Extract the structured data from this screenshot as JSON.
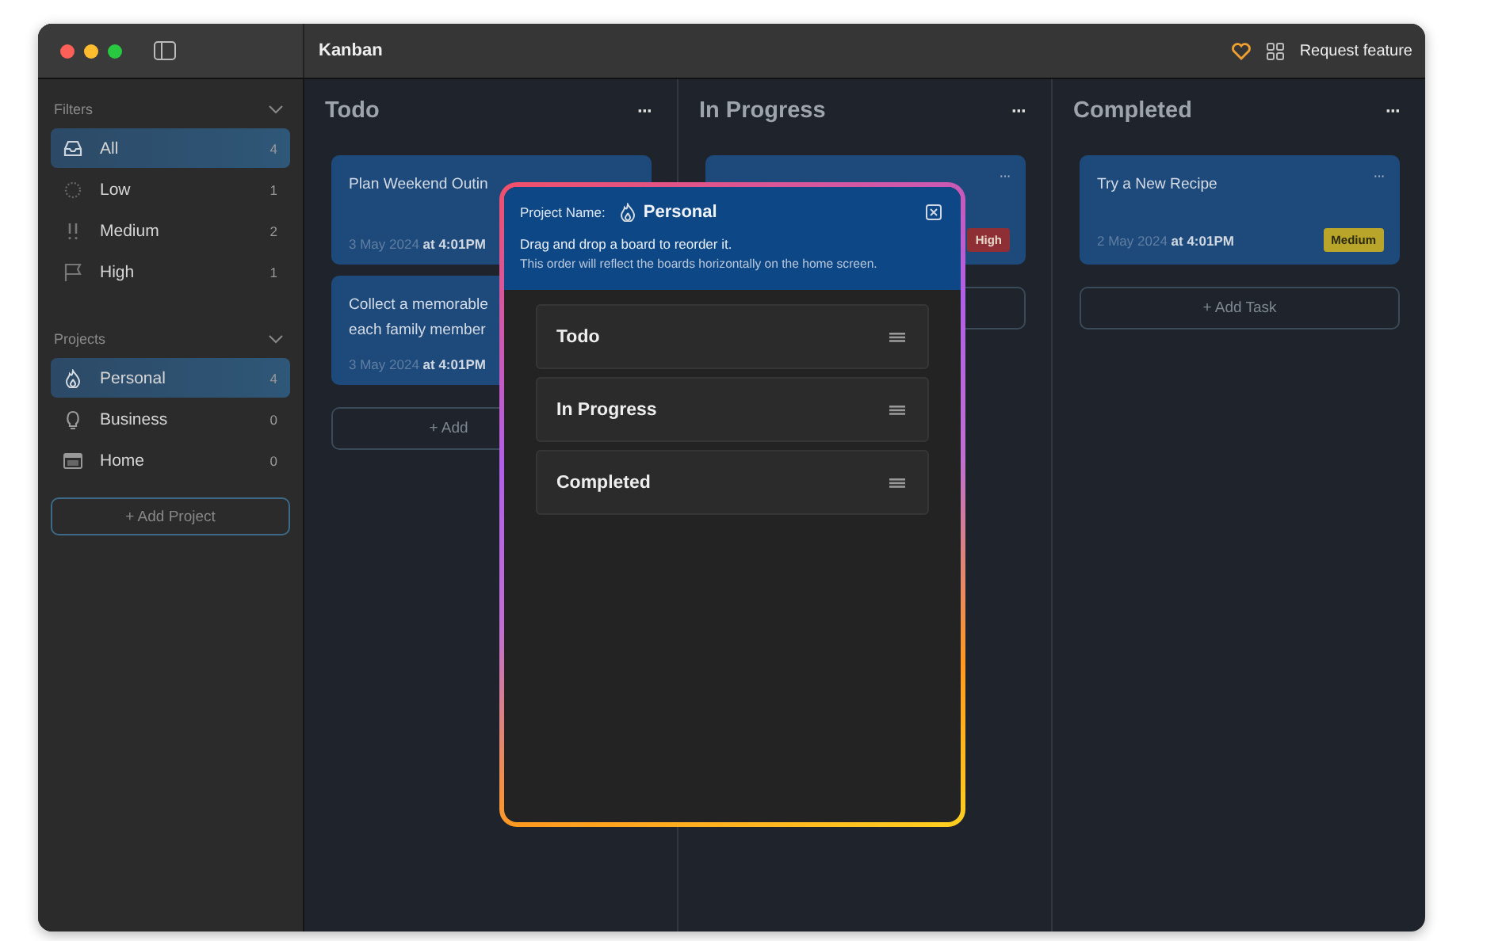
{
  "window": {
    "title": "Kanban",
    "request_label": "Request feature"
  },
  "sidebar": {
    "sections": [
      {
        "title": "Filters",
        "expanded": true,
        "items": [
          {
            "label": "All",
            "count": "4",
            "selected": true
          },
          {
            "label": "Low",
            "count": "1",
            "selected": false
          },
          {
            "label": "Medium",
            "count": "2",
            "selected": false
          },
          {
            "label": "High",
            "count": "1",
            "selected": false
          }
        ]
      },
      {
        "title": "Projects",
        "expanded": true,
        "items": [
          {
            "label": "Personal",
            "count": "4",
            "selected": true
          },
          {
            "label": "Business",
            "count": "0",
            "selected": false
          },
          {
            "label": "Home",
            "count": "0",
            "selected": false
          }
        ]
      }
    ],
    "add_button": "+ Add Project"
  },
  "columns": [
    {
      "title": "Todo",
      "more": "···",
      "cards": [
        {
          "title": "Plan Weekend Outin",
          "date": "3 May 2024 **at 4:01PM**"
        },
        {
          "title": "Collect a memorable each family member",
          "date": "3 May 2024 **at 4:01PM**"
        }
      ],
      "add_label": "+ Add"
    },
    {
      "title": "In Progress",
      "more": "···",
      "cards": [
        {
          "more": "···",
          "priority": "High",
          "color": "#8e2f35"
        }
      ]
    },
    {
      "title": "Completed",
      "more": "···",
      "cards": [
        {
          "title": "Try a New Recipe",
          "more": "···",
          "date": "2 May 2024 **at 4:01PM**",
          "priority": "Medium",
          "color": "#b8a52a"
        }
      ],
      "add_label": "+ Add Task"
    }
  ],
  "modal": {
    "name_label": "Project Name:",
    "project": "Personal",
    "instruction": "Drag and drop a board to reorder it.",
    "note": "This order will reflect the boards horizontally on the home screen.",
    "boards": [
      "Todo",
      "In Progress",
      "Completed"
    ]
  }
}
